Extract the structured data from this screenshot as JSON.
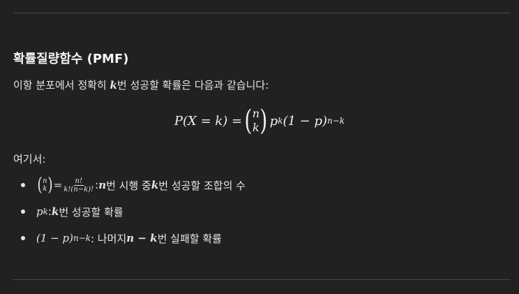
{
  "heading": "확률질량함수 (PMF)",
  "intro": {
    "before": "이항 분포에서 정확히 ",
    "var": "k",
    "after": "번 성공할 확률은 다음과 같습니다:"
  },
  "formula": {
    "lhs": "P(X = k) = ",
    "binom_top": "n",
    "binom_bottom": "k",
    "p": "p",
    "p_exp": "k",
    "rest": "(1 − p)",
    "rest_exp": "n−k"
  },
  "where_label": "여기서:",
  "bullets": [
    {
      "binom_top": "n",
      "binom_bottom": "k",
      "eq": " = ",
      "frac_num": "n!",
      "frac_den": "k!(n−k)!",
      "colon": ": ",
      "var1": "n",
      "text1": "번 시행 중 ",
      "var2": "k",
      "text2": "번 성공할 조합의 수"
    },
    {
      "base": "p",
      "exp": "k",
      "colon": ": ",
      "var": "k",
      "text": "번 성공할 확률"
    },
    {
      "base": "(1 − p)",
      "exp": "n−k",
      "colon": ": 나머지 ",
      "var": "n − k",
      "text": "번 실패할 확률"
    }
  ]
}
